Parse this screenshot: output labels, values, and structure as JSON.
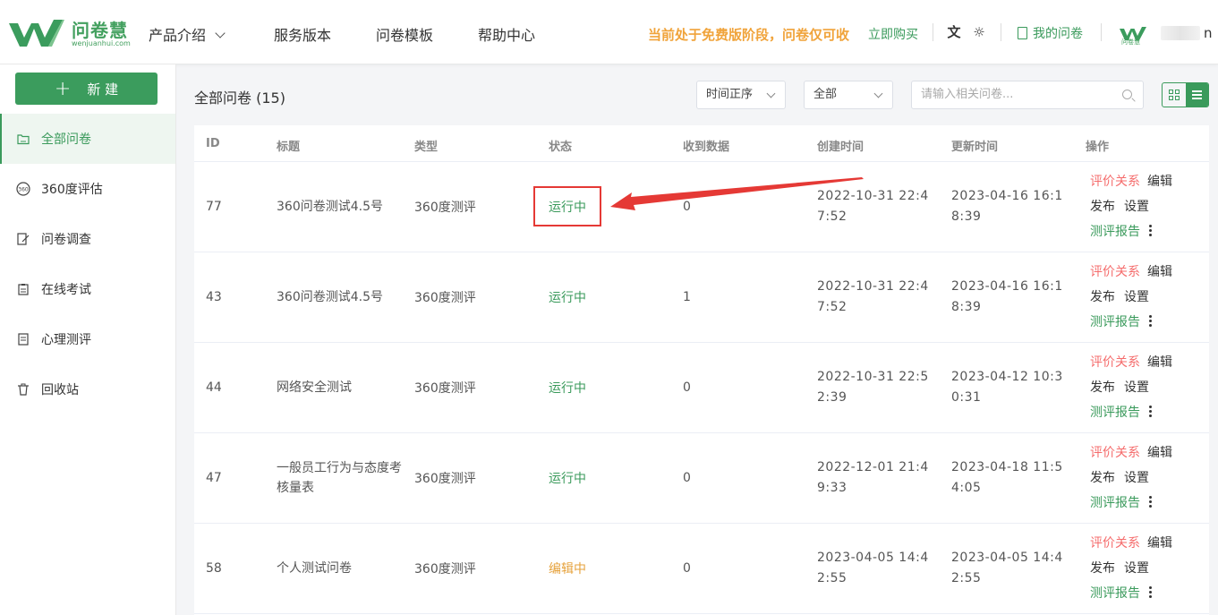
{
  "brand": {
    "name": "问卷慧",
    "domain": "wenjuanhui.com",
    "small_name": "问卷慧"
  },
  "nav": {
    "items": [
      "产品介绍",
      "服务版本",
      "问卷模板",
      "帮助中心"
    ]
  },
  "header": {
    "notice": "当前处于免费版阶段，问卷仅可收",
    "buy_label": "立即购买",
    "my_surveys": "我的问卷",
    "user_suffix": "n"
  },
  "sidebar": {
    "new_button": "新 建",
    "items": [
      {
        "label": "全部问卷",
        "icon": "folder-icon",
        "active": true
      },
      {
        "label": "360度评估",
        "icon": "360-icon",
        "active": false
      },
      {
        "label": "问卷调查",
        "icon": "edit-survey-icon",
        "active": false
      },
      {
        "label": "在线考试",
        "icon": "clipboard-icon",
        "active": false
      },
      {
        "label": "心理测评",
        "icon": "document-icon",
        "active": false
      },
      {
        "label": "回收站",
        "icon": "trash-icon",
        "active": false
      }
    ]
  },
  "main": {
    "title": "全部问卷 (15)",
    "sort_select": "时间正序",
    "filter_select": "全部",
    "search_placeholder": "请输入相关问卷..."
  },
  "table": {
    "columns": [
      "ID",
      "标题",
      "类型",
      "状态",
      "收到数据",
      "创建时间",
      "更新时间",
      "操作"
    ],
    "rows": [
      {
        "id": "77",
        "title": "360问卷测试4.5号",
        "type": "360度测评",
        "status": "运行中",
        "status_kind": "running",
        "received": "0",
        "created": "2022-10-31 22:47:52",
        "updated": "2023-04-16 16:18:39"
      },
      {
        "id": "43",
        "title": "360问卷测试4.5号",
        "type": "360度测评",
        "status": "运行中",
        "status_kind": "running",
        "received": "1",
        "created": "2022-10-31 22:47:52",
        "updated": "2023-04-16 16:18:39"
      },
      {
        "id": "44",
        "title": "网络安全测试",
        "type": "360度测评",
        "status": "运行中",
        "status_kind": "running",
        "received": "0",
        "created": "2022-10-31 22:52:39",
        "updated": "2023-04-12 10:30:31"
      },
      {
        "id": "47",
        "title": "一般员工行为与态度考核量表",
        "type": "360度测评",
        "status": "运行中",
        "status_kind": "running",
        "received": "0",
        "created": "2022-12-01 21:49:33",
        "updated": "2023-04-18 11:54:05"
      },
      {
        "id": "58",
        "title": "个人测试问卷",
        "type": "360度测评",
        "status": "编辑中",
        "status_kind": "editing",
        "received": "0",
        "created": "2023-04-05 14:42:55",
        "updated": "2023-04-05 14:42:55"
      }
    ],
    "actions": {
      "relation": "评价关系",
      "edit": "编辑",
      "publish": "发布",
      "settings": "设置",
      "report": "测评报告"
    }
  },
  "colors": {
    "brand_green": "#3a9a5b",
    "notice_orange": "#f0a33a",
    "annotation_red": "#e53935",
    "relation_red": "#f56c6c",
    "editing_orange": "#e6a23c"
  }
}
